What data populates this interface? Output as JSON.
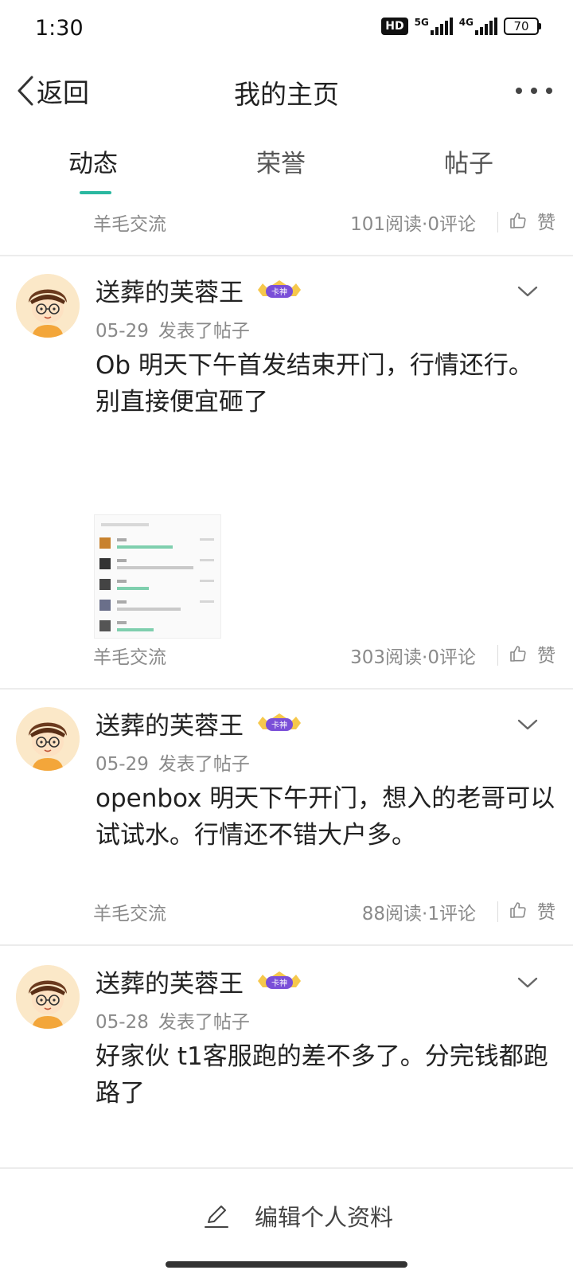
{
  "status_bar": {
    "time": "1:30",
    "hd_label": "HD",
    "net1": "5G",
    "net2": "4G",
    "battery": "70"
  },
  "nav": {
    "back_label": "返回",
    "title": "我的主页"
  },
  "tabs": [
    {
      "label": "动态"
    },
    {
      "label": "荣誉"
    },
    {
      "label": "帖子"
    }
  ],
  "top_meta": {
    "community": "羊毛交流",
    "stats": "101阅读·0评论",
    "like_label": "赞"
  },
  "posts": [
    {
      "username": "送葬的芙蓉王",
      "date": "05-29",
      "action": "发表了帖子",
      "body": "Ob 明天下午首发结束开门，行情还行。别直接便宜砸了",
      "community": "羊毛交流",
      "stats": "303阅读·0评论",
      "like_label": "赞"
    },
    {
      "username": "送葬的芙蓉王",
      "date": "05-29",
      "action": "发表了帖子",
      "body": "openbox 明天下午开门，想入的老哥可以试试水。行情还不错大户多。",
      "community": "羊毛交流",
      "stats": "88阅读·1评论",
      "like_label": "赞"
    },
    {
      "username": "送葬的芙蓉王",
      "date": "05-28",
      "action": "发表了帖子",
      "body": "好家伙 t1客服跑的差不多了。分完钱都跑路了"
    }
  ],
  "badge_text": "卡神",
  "bottom": {
    "edit_label": "编辑个人资料"
  },
  "colors": {
    "accent": "#2ab8a0",
    "meta_text": "#8a8a8a",
    "badge": "#7a4fd8"
  },
  "icons": [
    "back-icon",
    "more-icon",
    "thumb-up-icon",
    "chevron-down-icon",
    "edit-icon",
    "avatar-icon",
    "rank-badge-icon"
  ]
}
